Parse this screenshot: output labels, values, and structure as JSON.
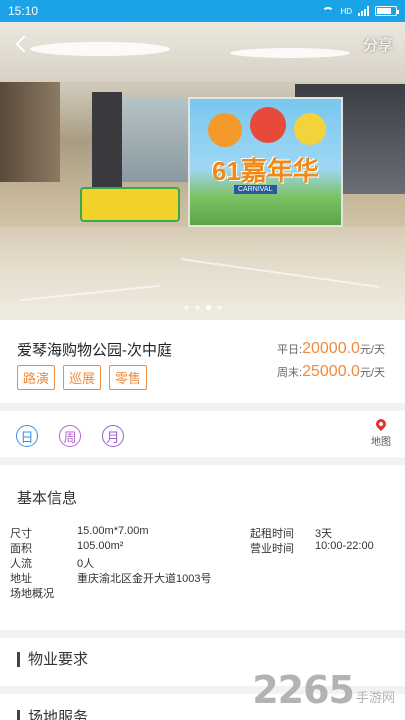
{
  "status_bar": {
    "time": "15:10",
    "net": "HD"
  },
  "header": {
    "share_label": "分享"
  },
  "carousel": {
    "count": 4,
    "active": 2
  },
  "billboard": {
    "title": "61嘉年华",
    "subtitle": "CARNIVAL"
  },
  "venue": {
    "title": "爱琴海购物公园-次中庭",
    "tags": [
      "路演",
      "巡展",
      "零售"
    ],
    "weekday_label": "平日:",
    "weekday_price": "20000.0",
    "weekend_label": "周末:",
    "weekend_price": "25000.0",
    "price_unit": "元/天"
  },
  "date_filters": [
    {
      "label": "日",
      "color": "#3a8ee6"
    },
    {
      "label": "周",
      "color": "#b06ad0"
    },
    {
      "label": "月",
      "color": "#9a5fd1"
    }
  ],
  "map": {
    "label": "地图"
  },
  "basic_info": {
    "title": "基本信息",
    "rows": [
      {
        "k1": "尺寸",
        "v1": "15.00m*7.00m",
        "k2": "起租时间",
        "v2": "3天"
      },
      {
        "k1": "面积",
        "v1": "105.00m²",
        "k2": "营业时间",
        "v2": "10:00-22:00"
      },
      {
        "k1": "人流",
        "v1": "0人",
        "k2": "",
        "v2": ""
      },
      {
        "k1": "地址",
        "v1": "重庆渝北区金开大道1003号",
        "k2": "",
        "v2": ""
      },
      {
        "k1": "场地概况",
        "v1": "",
        "k2": "",
        "v2": ""
      }
    ]
  },
  "property": {
    "title": "物业要求"
  },
  "service": {
    "title": "场地服务"
  },
  "watermark": {
    "num": "2265",
    "cn": "手游网",
    "sub": ""
  },
  "colors": {
    "accent": "#f08a3c",
    "status_bar": "#1aa3e6"
  }
}
